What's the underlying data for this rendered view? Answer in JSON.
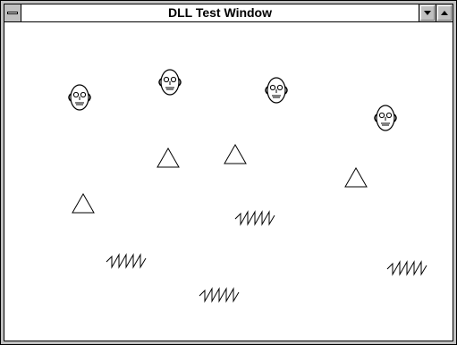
{
  "window": {
    "title": "DLL Test Window"
  },
  "icons": {
    "system_menu": "system-menu-bar",
    "minimize": "minimize-arrow-down",
    "maximize": "maximize-arrow-up"
  },
  "canvas": {
    "faces": 4,
    "triangles": 4,
    "zigzags": 4
  }
}
